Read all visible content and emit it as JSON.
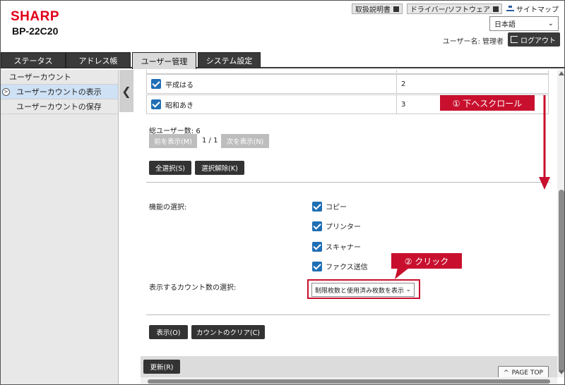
{
  "header": {
    "brand": "SHARP",
    "model": "BP-22C20",
    "links": [
      "取扱説明書",
      "ドライバー/ソフトウェア"
    ],
    "sitemap": "サイトマップ",
    "language": "日本語",
    "username": "ユーザー名: 管理者",
    "logout": "ログアウト"
  },
  "tabs": [
    "ステータス",
    "アドレス帳",
    "ユーザー管理",
    "システム設定"
  ],
  "sidebar": {
    "title": "ユーザーカウント",
    "items": [
      "ユーザーカウントの表示",
      "ユーザーカウントの保存"
    ]
  },
  "table": {
    "rows": [
      {
        "name": "平成はる",
        "value": "2"
      },
      {
        "name": "昭和あき",
        "value": "3"
      }
    ]
  },
  "pager": {
    "total": "総ユーザー数: 6",
    "prev": "前を表示(M)",
    "page": "1 / 1",
    "next": "次を表示(N)"
  },
  "select_buttons": {
    "all": "全選択(S)",
    "none": "選択解除(K)"
  },
  "functions": {
    "label": "機能の選択:",
    "options": [
      "コピー",
      "プリンター",
      "スキャナー",
      "ファクス送信"
    ]
  },
  "count_select": {
    "label": "表示するカウント数の選択:",
    "value": "制限枚数と使用済み枚数を表示"
  },
  "actions": {
    "display": "表示(O)",
    "clear": "カウントのクリア(C)",
    "update": "更新(R)"
  },
  "pagetop": "PAGE TOP",
  "annotations": {
    "scroll": "① 下へスクロール",
    "click": "② クリック"
  },
  "colors": {
    "accent_red": "#c8102e",
    "checkbox_blue": "#1f6fb5",
    "tab_dark": "#3a3a3a"
  }
}
